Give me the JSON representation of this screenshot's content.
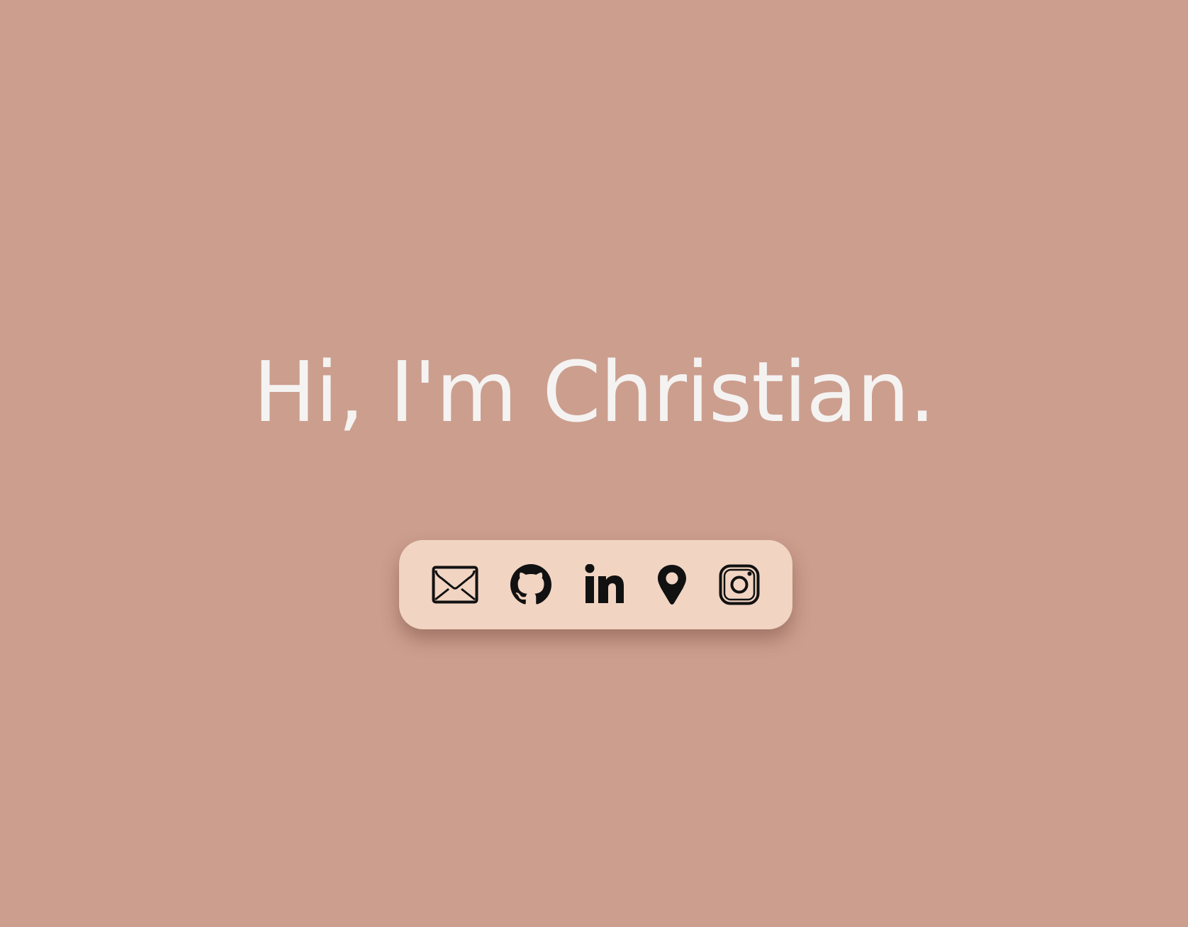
{
  "page": {
    "background_color": "#cc9e8e"
  },
  "hero": {
    "title": "Hi, I'm Christian.",
    "text_color": "#f4f3f2"
  },
  "social_bar": {
    "background_color": "#f1d4c2",
    "icon_color": "#111111",
    "icons": [
      {
        "name": "envelope-icon"
      },
      {
        "name": "github-icon"
      },
      {
        "name": "linkedin-icon"
      },
      {
        "name": "location-pin-icon"
      },
      {
        "name": "instagram-icon"
      }
    ]
  }
}
